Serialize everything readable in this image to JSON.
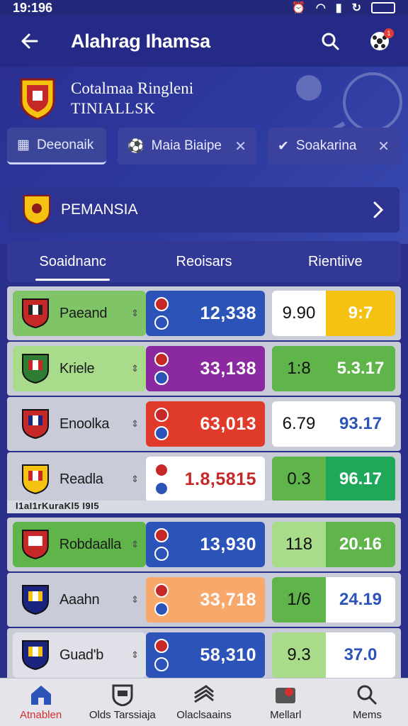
{
  "status": {
    "time": "19:196"
  },
  "appbar": {
    "title": "Alahrag Ihamsa"
  },
  "hero": {
    "title": "Cotalmaa Ringleni",
    "subtitle": "TINIALLSK",
    "chips": [
      {
        "label": "Deeonaik"
      },
      {
        "label": "Maia Biaipe"
      },
      {
        "label": "Soakarina"
      }
    ],
    "league": {
      "name": "PEMANSIA"
    }
  },
  "tabs": [
    {
      "label": "Soaidnanc"
    },
    {
      "label": "Reoisars"
    },
    {
      "label": "Rientiive"
    }
  ],
  "rows": [
    {
      "team": "Paeand",
      "score": "12,338",
      "odd_a": "9.90",
      "odd_b": "9:7"
    },
    {
      "team": "Kriele",
      "score": "33,138",
      "odd_a": "1:8",
      "odd_b": "5.3.17"
    },
    {
      "team": "Enoolka",
      "score": "63,013",
      "odd_a": "6.79",
      "odd_b": "93.17"
    },
    {
      "team": "Readla",
      "score": "1.8,5815",
      "odd_a": "0.3",
      "odd_b": "96.17"
    },
    {
      "team": "Robdaalla",
      "score": "13,930",
      "odd_a": "118",
      "odd_b": "20.16"
    },
    {
      "team": "Aaahn",
      "score": "33,718",
      "odd_a": "1/6",
      "odd_b": "24.19"
    },
    {
      "team": "Guad'b",
      "score": "58,310",
      "odd_a": "9.3",
      "odd_b": "37.0"
    }
  ],
  "divider_text": "I1aI1rKuraKl5 I9I5",
  "nav": [
    {
      "label": "Atnablen"
    },
    {
      "label": "Olds Tarssiaja"
    },
    {
      "label": "Olaclsaains"
    },
    {
      "label": "Mellarl"
    },
    {
      "label": "Mems"
    }
  ],
  "colors": {
    "primary": "#2a2f8a",
    "green": "#5fb54a",
    "light_green": "#a8db8a",
    "yellow": "#f5c211",
    "blue_score": "#2c54b8",
    "purple_score": "#8b2aa0",
    "red_score": "#e03a2a",
    "orange_score": "#f7a86a",
    "teal_green": "#1fa85a",
    "accent_red": "#d32f2f"
  }
}
